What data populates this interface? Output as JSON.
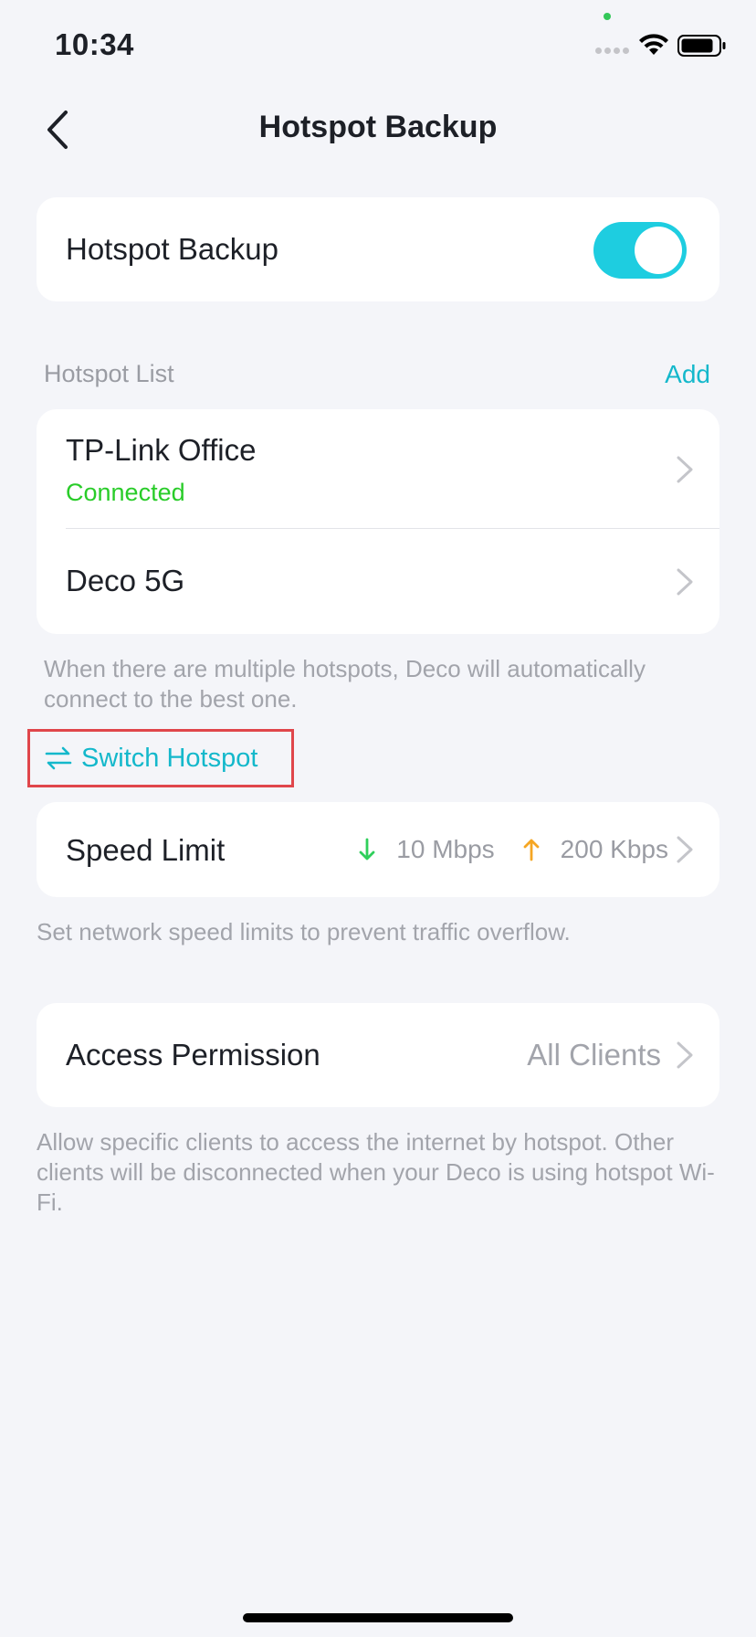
{
  "status_bar": {
    "time": "10:34",
    "signal_icon": "cellular-dots-icon",
    "wifi_icon": "wifi-icon",
    "battery_icon": "battery-icon"
  },
  "nav": {
    "back_icon": "chevron-left-icon",
    "title": "Hotspot Backup"
  },
  "backup_toggle": {
    "label": "Hotspot Backup",
    "enabled": true,
    "accent_color": "#1ecde0"
  },
  "hotspot_list": {
    "header": "Hotspot List",
    "add_label": "Add",
    "items": [
      {
        "name": "TP-Link Office",
        "status": "Connected"
      },
      {
        "name": "Deco 5G",
        "status": ""
      }
    ],
    "hint": "When there are multiple hotspots, Deco will automatically connect to the best one."
  },
  "switch_hotspot": {
    "icon": "switch-arrows-icon",
    "label": "Switch Hotspot"
  },
  "speed_limit": {
    "label": "Speed Limit",
    "download": "10 Mbps",
    "upload": "200 Kbps",
    "download_color": "#2fcf5b",
    "upload_color": "#f5a623",
    "hint": "Set network speed limits to prevent traffic overflow."
  },
  "access_permission": {
    "label": "Access Permission",
    "value": "All Clients",
    "hint": "Allow specific clients to access the internet by hotspot. Other clients will be disconnected when your Deco is using hotspot Wi-Fi."
  }
}
